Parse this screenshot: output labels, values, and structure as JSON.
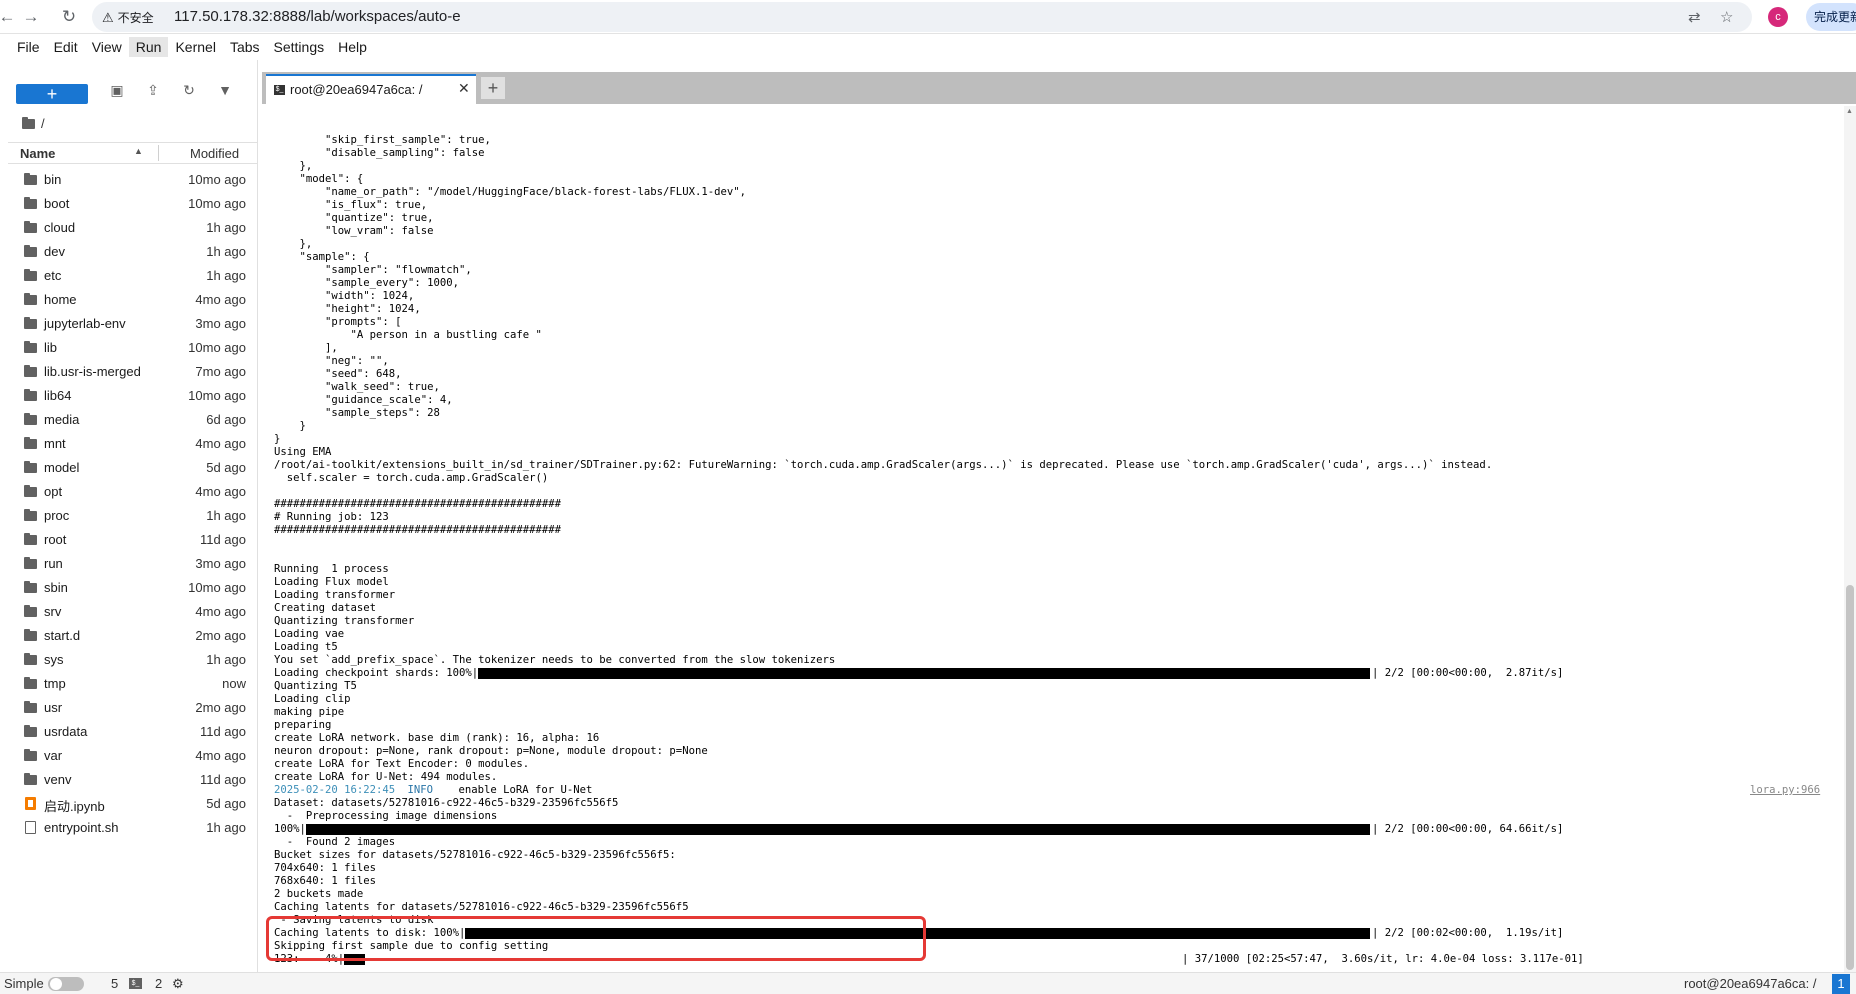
{
  "browser": {
    "back_icon": "arrow-left-icon",
    "forward_icon": "arrow-right-icon",
    "reload_icon": "reload-icon",
    "insecure_label": "不安全",
    "url": "117.50.178.32:8888/lab/workspaces/auto-e",
    "profile_initial": "c",
    "update_label": "完成更新"
  },
  "menu": [
    "File",
    "Edit",
    "View",
    "Run",
    "Kernel",
    "Tabs",
    "Settings",
    "Help"
  ],
  "file_browser": {
    "new_button": "+",
    "breadcrumb": "/",
    "header_name": "Name",
    "header_modified": "Modified",
    "files": [
      {
        "name": "bin",
        "modified": "10mo ago",
        "type": "folder"
      },
      {
        "name": "boot",
        "modified": "10mo ago",
        "type": "folder"
      },
      {
        "name": "cloud",
        "modified": "1h ago",
        "type": "folder"
      },
      {
        "name": "dev",
        "modified": "1h ago",
        "type": "folder"
      },
      {
        "name": "etc",
        "modified": "1h ago",
        "type": "folder"
      },
      {
        "name": "home",
        "modified": "4mo ago",
        "type": "folder"
      },
      {
        "name": "jupyterlab-env",
        "modified": "3mo ago",
        "type": "folder"
      },
      {
        "name": "lib",
        "modified": "10mo ago",
        "type": "folder"
      },
      {
        "name": "lib.usr-is-merged",
        "modified": "7mo ago",
        "type": "folder"
      },
      {
        "name": "lib64",
        "modified": "10mo ago",
        "type": "folder"
      },
      {
        "name": "media",
        "modified": "6d ago",
        "type": "folder"
      },
      {
        "name": "mnt",
        "modified": "4mo ago",
        "type": "folder"
      },
      {
        "name": "model",
        "modified": "5d ago",
        "type": "folder"
      },
      {
        "name": "opt",
        "modified": "4mo ago",
        "type": "folder"
      },
      {
        "name": "proc",
        "modified": "1h ago",
        "type": "folder"
      },
      {
        "name": "root",
        "modified": "11d ago",
        "type": "folder"
      },
      {
        "name": "run",
        "modified": "3mo ago",
        "type": "folder"
      },
      {
        "name": "sbin",
        "modified": "10mo ago",
        "type": "folder"
      },
      {
        "name": "srv",
        "modified": "4mo ago",
        "type": "folder"
      },
      {
        "name": "start.d",
        "modified": "2mo ago",
        "type": "folder"
      },
      {
        "name": "sys",
        "modified": "1h ago",
        "type": "folder"
      },
      {
        "name": "tmp",
        "modified": "now",
        "type": "folder"
      },
      {
        "name": "usr",
        "modified": "2mo ago",
        "type": "folder"
      },
      {
        "name": "usrdata",
        "modified": "11d ago",
        "type": "folder"
      },
      {
        "name": "var",
        "modified": "4mo ago",
        "type": "folder"
      },
      {
        "name": "venv",
        "modified": "11d ago",
        "type": "folder"
      },
      {
        "name": "启动.ipynb",
        "modified": "5d ago",
        "type": "notebook"
      },
      {
        "name": "entrypoint.sh",
        "modified": "1h ago",
        "type": "file"
      }
    ]
  },
  "tab": {
    "label": "root@20ea6947a6ca: /",
    "close": "✕",
    "add": "+"
  },
  "terminal": {
    "lines": [
      "        \"skip_first_sample\": true,",
      "        \"disable_sampling\": false",
      "    },",
      "    \"model\": {",
      "        \"name_or_path\": \"/model/HuggingFace/black-forest-labs/FLUX.1-dev\",",
      "        \"is_flux\": true,",
      "        \"quantize\": true,",
      "        \"low_vram\": false",
      "    },",
      "    \"sample\": {",
      "        \"sampler\": \"flowmatch\",",
      "        \"sample_every\": 1000,",
      "        \"width\": 1024,",
      "        \"height\": 1024,",
      "        \"prompts\": [",
      "            \"A person in a bustling cafe \"",
      "        ],",
      "        \"neg\": \"\",",
      "        \"seed\": 648,",
      "        \"walk_seed\": true,",
      "        \"guidance_scale\": 4,",
      "        \"sample_steps\": 28",
      "    }",
      "}",
      "Using EMA",
      "/root/ai-toolkit/extensions_built_in/sd_trainer/SDTrainer.py:62: FutureWarning: `torch.cuda.amp.GradScaler(args...)` is deprecated. Please use `torch.amp.GradScaler('cuda', args...)` instead.",
      "  self.scaler = torch.cuda.amp.GradScaler()",
      "",
      "#############################################",
      "# Running job: 123",
      "#############################################",
      "",
      "",
      "Running  1 process",
      "Loading Flux model",
      "Loading transformer",
      "Creating dataset",
      "Quantizing transformer",
      "Loading vae",
      "Loading t5",
      "You set `add_prefix_space`. The tokenizer needs to be converted from the slow tokenizers",
      "Loading checkpoint shards: 100%|",
      "Quantizing T5",
      "Loading clip",
      "making pipe",
      "preparing",
      "create LoRA network. base dim (rank): 16, alpha: 16",
      "neuron dropout: p=None, rank dropout: p=None, module dropout: p=None",
      "create LoRA for Text Encoder: 0 modules.",
      "create LoRA for U-Net: 494 modules.",
      "2025-02-20 16:22:45",
      "Dataset: datasets/52781016-c922-46c5-b329-23596fc556f5",
      "  -  Preprocessing image dimensions",
      "100%|",
      "  -  Found 2 images",
      "Bucket sizes for datasets/52781016-c922-46c5-b329-23596fc556f5:",
      "704x640: 1 files",
      "768x640: 1 files",
      "2 buckets made",
      "Caching latents for datasets/52781016-c922-46c5-b329-23596fc556f5",
      " - Saving latents to disk",
      "Caching latents to disk: 100%|",
      "Skipping first sample due to config setting",
      "123:    4%|"
    ],
    "info_level": "INFO",
    "info_message": "enable LoRA for U-Net",
    "info_source": "lora.py:966",
    "progress_checkpoint_suffix": "| 2/2 [00:00<00:00,  2.87it/s]",
    "progress_preprocess_suffix": "| 2/2 [00:00<00:00, 64.66it/s]",
    "progress_latents_suffix": "| 2/2 [00:02<00:00,  1.19s/it]",
    "progress_job_suffix": "| 37/1000 [02:25<57:47,  3.60s/it, lr: 4.0e-04 loss: 3.117e-01]",
    "progress_job_fraction": 0.04
  },
  "status_bar": {
    "mode_label": "Simple",
    "terminal_count": "5",
    "kernel_count": "2",
    "right_label": "root@20ea6947a6ca: /",
    "badge": "1"
  }
}
